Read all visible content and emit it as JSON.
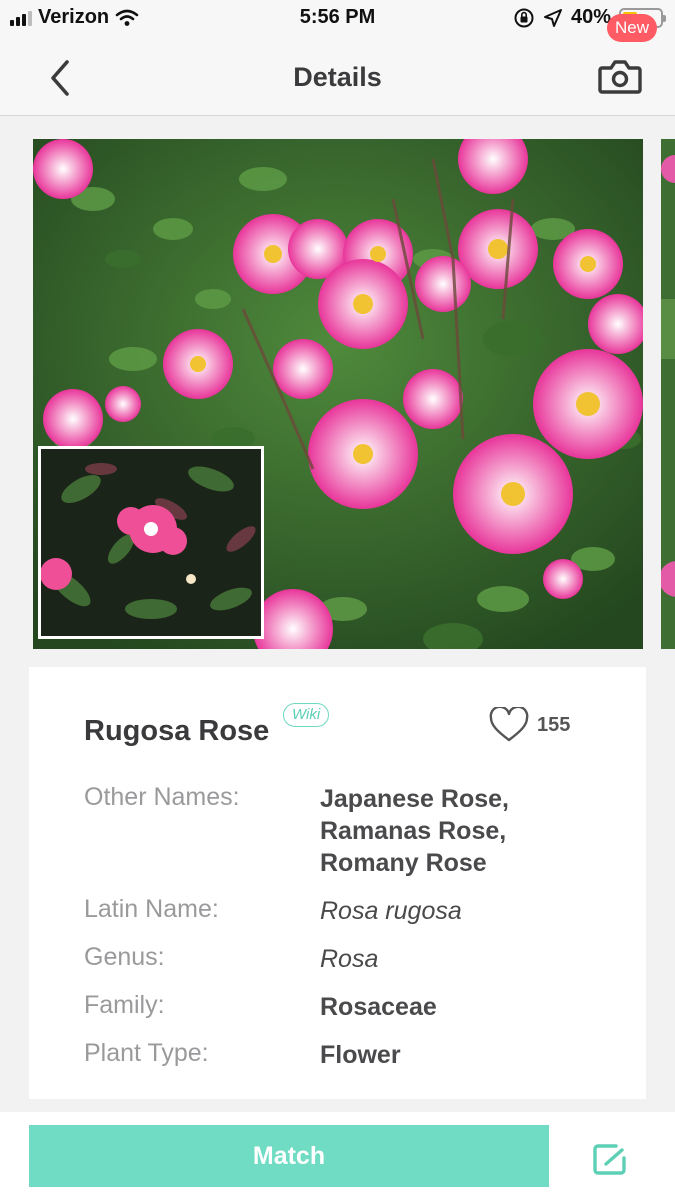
{
  "status_bar": {
    "carrier": "Verizon",
    "time": "5:56 PM",
    "battery_text": "40%",
    "battery_level": 0.4,
    "battery_color": "#f5c400"
  },
  "nav": {
    "title": "Details",
    "back_icon": "chevron-left-icon",
    "camera_icon": "camera-icon"
  },
  "plant": {
    "name": "Rugosa Rose",
    "wiki_label": "Wiki",
    "likes": "155",
    "details": [
      {
        "label": "Other Names:",
        "value": [
          "Japanese Rose,",
          "Ramanas Rose,",
          "Romany Rose"
        ],
        "italic": false
      },
      {
        "label": "Latin Name:",
        "value": [
          "Rosa rugosa"
        ],
        "italic": true
      },
      {
        "label": "Genus:",
        "value": [
          "Rosa"
        ],
        "italic": true
      },
      {
        "label": "Family:",
        "value": [
          "Rosaceae"
        ],
        "italic": false
      },
      {
        "label": "Plant Type:",
        "value": [
          "Flower"
        ],
        "italic": false
      }
    ]
  },
  "bottom": {
    "match_label": "Match",
    "new_badge": "New",
    "accent_color": "#6fdcc3"
  }
}
